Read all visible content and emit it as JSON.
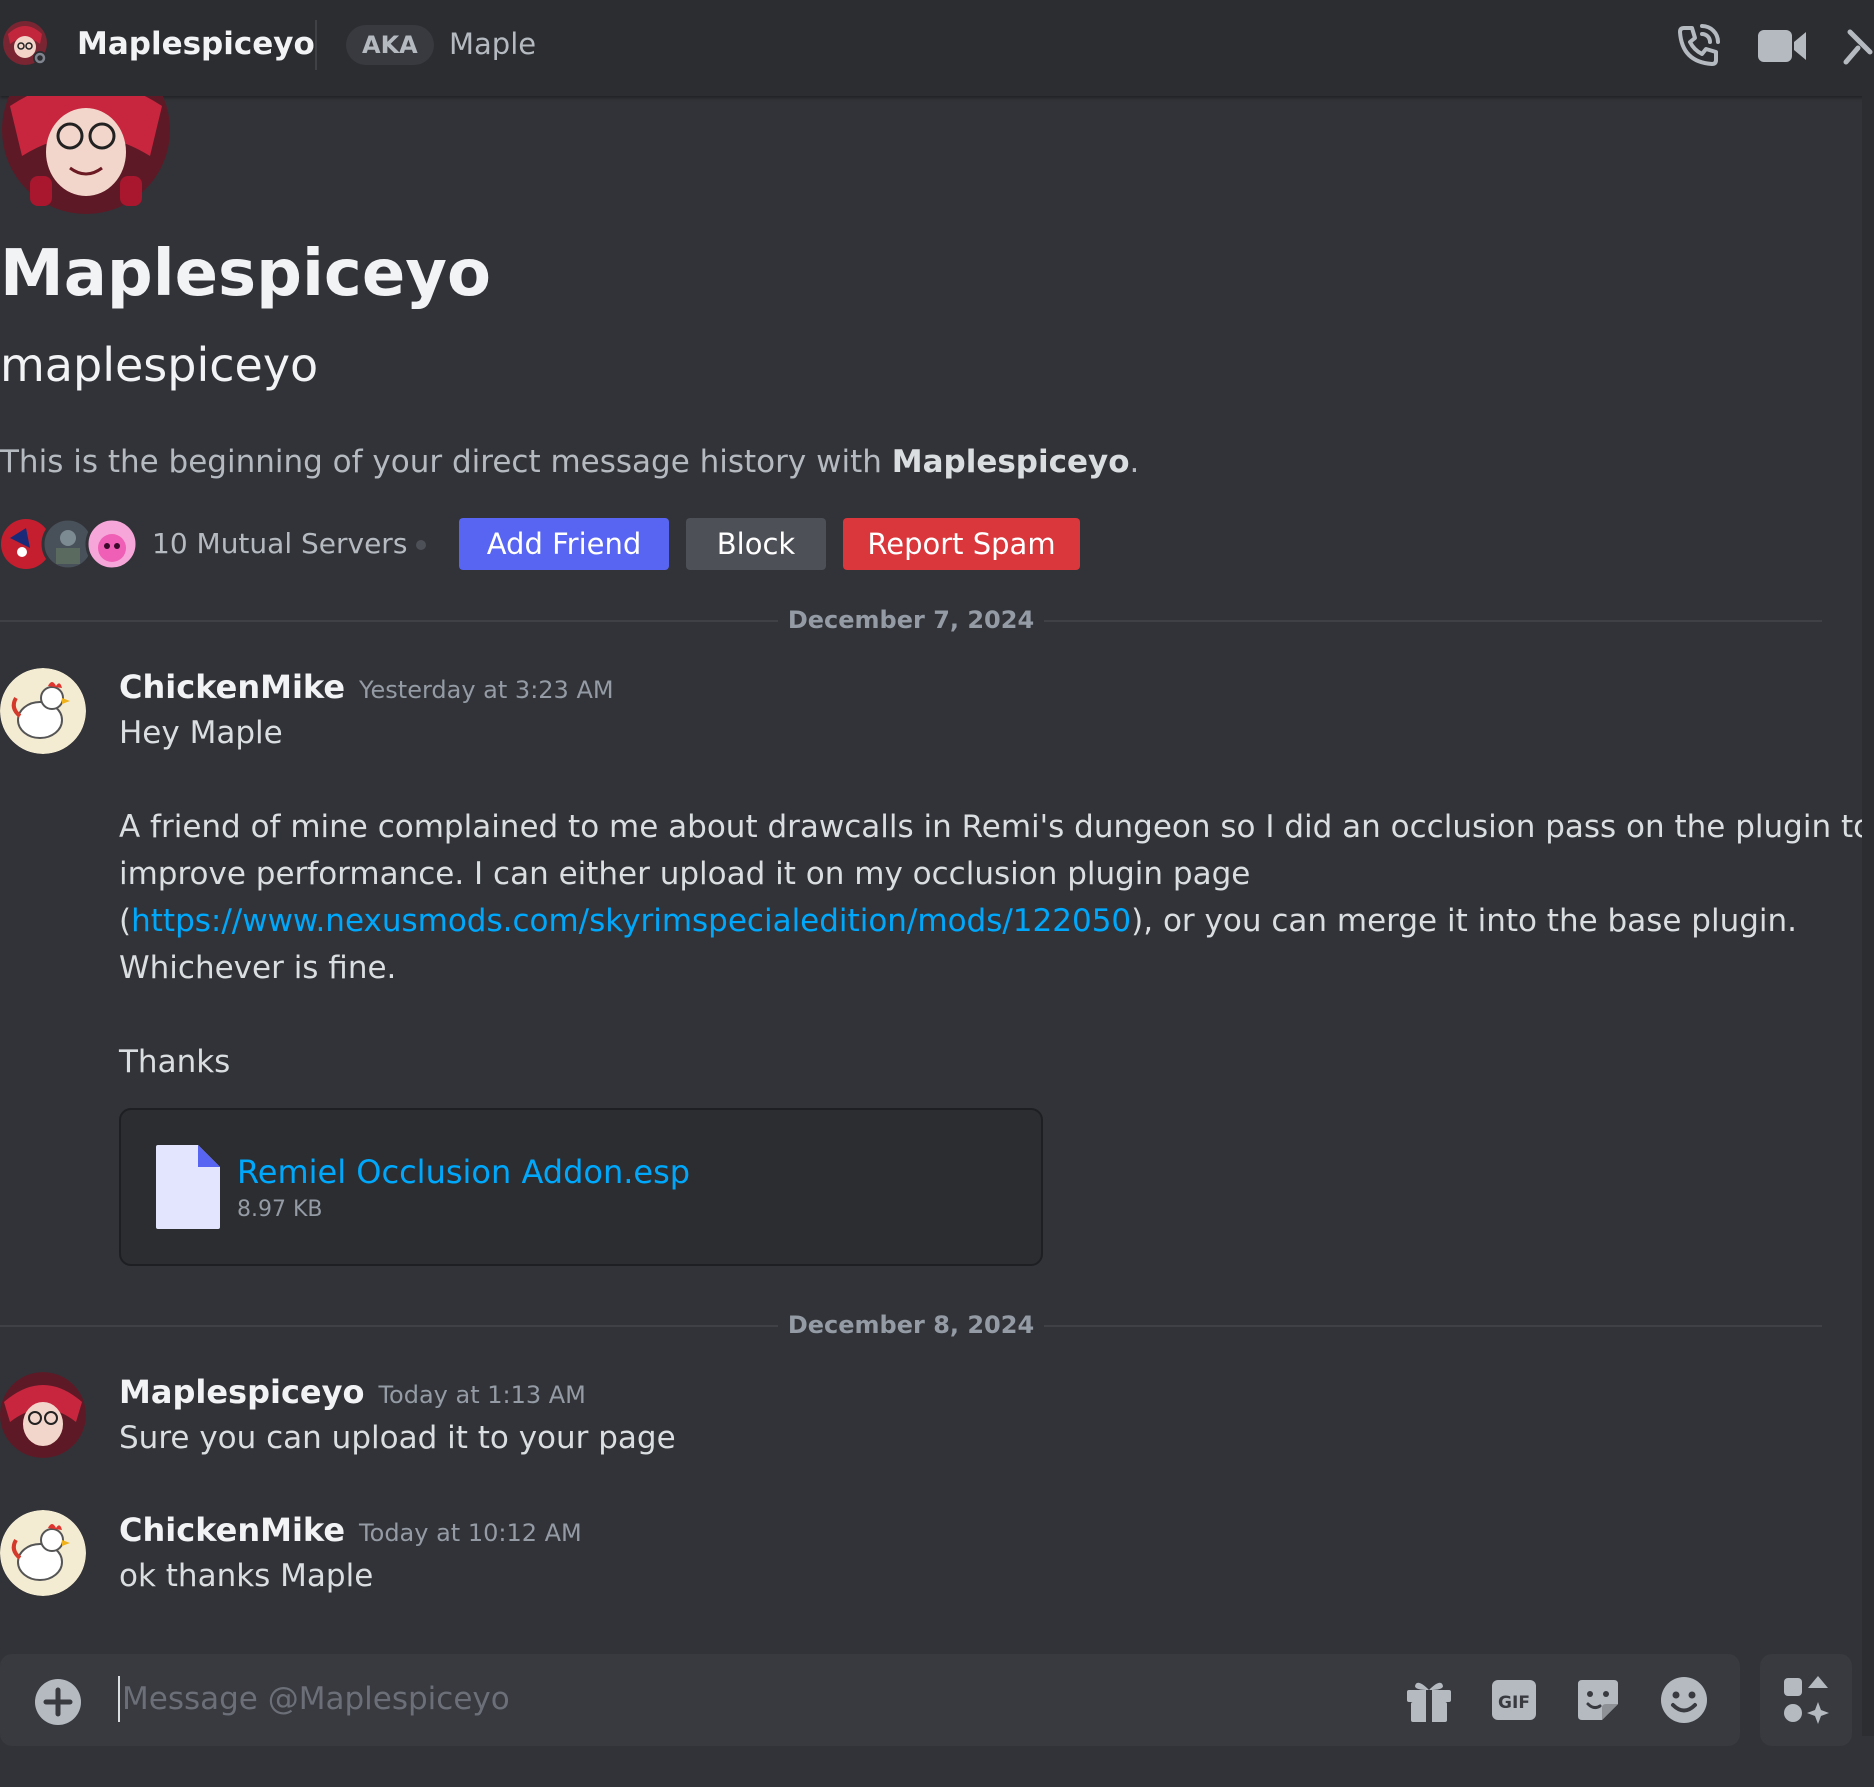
{
  "colors": {
    "background": "#313338",
    "header": "#2b2d31",
    "accent": "#5865f2",
    "danger": "#da373c",
    "link": "#00a8fc"
  },
  "header": {
    "title": "Maplespiceyo",
    "aka_label": "AKA",
    "aka_value": "Maple",
    "icons": [
      "avatar-icon",
      "phone-call-icon",
      "video-call-icon",
      "pin-icon"
    ]
  },
  "profile": {
    "display_name": "Maplespiceyo",
    "username": "maplespiceyo",
    "intro_prefix": "This is the beginning of your direct message history with ",
    "intro_name": "Maplespiceyo",
    "intro_suffix": ".",
    "mutual_servers": "10 Mutual Servers",
    "buttons": {
      "add_friend": "Add Friend",
      "block": "Block",
      "report_spam": "Report Spam"
    }
  },
  "dates": [
    "December 7, 2024",
    "December 8, 2024"
  ],
  "messages": [
    {
      "author": "ChickenMike",
      "timestamp": "Yesterday at 3:23 AM",
      "line1": "Hey Maple",
      "line2": "A friend of mine complained to me about drawcalls in Remi's dungeon so I did an occlusion pass on the plugin to",
      "line3": "improve performance. I can either upload it on my occlusion plugin page",
      "line4_open": "(",
      "link": "https://www.nexusmods.com/skyrimspecialedition/mods/122050",
      "line4_close": "), or you can merge it into the base plugin.",
      "line5": "Whichever is fine.",
      "line6": "Thanks",
      "attachment": {
        "name": "Remiel Occlusion Addon.esp",
        "size": "8.97 KB",
        "icon": "file-icon"
      }
    },
    {
      "author": "Maplespiceyo",
      "timestamp": "Today at 1:13 AM",
      "text": "Sure you can upload it to your page"
    },
    {
      "author": "ChickenMike",
      "timestamp": "Today at 10:12 AM",
      "text": "ok thanks Maple"
    }
  ],
  "composer": {
    "placeholder": "Message @Maplespiceyo",
    "icons": [
      "add-attachment-icon",
      "gift-icon",
      "gif-icon",
      "sticker-icon",
      "emoji-icon",
      "apps-icon"
    ]
  }
}
